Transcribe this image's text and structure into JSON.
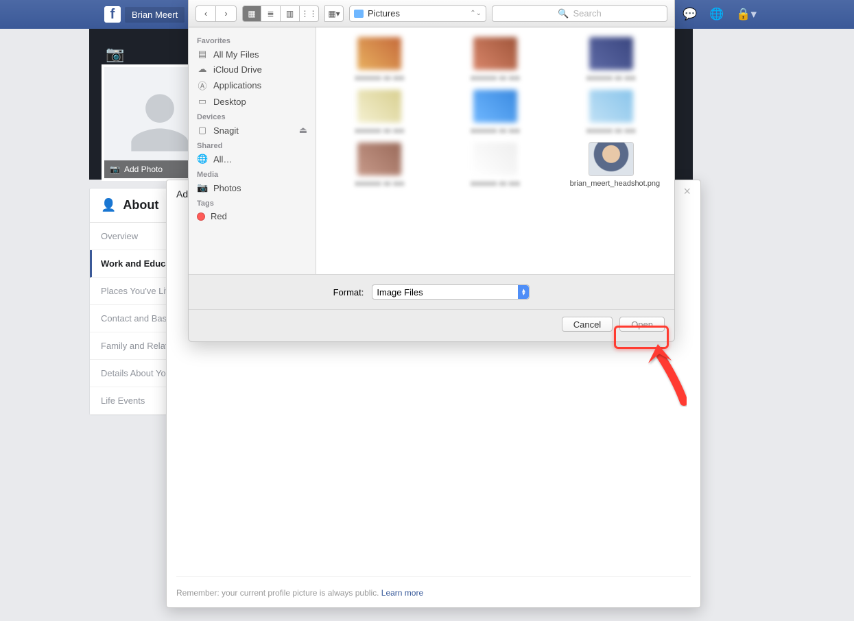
{
  "facebook": {
    "user_name": "Brian Meert",
    "add_photo_label": "Add Photo",
    "about_header": "About",
    "about_items": [
      "Overview",
      "Work and Education",
      "Places You've Lived",
      "Contact and Basic Info",
      "Family and Relationships",
      "Details About You",
      "Life Events"
    ],
    "active_index": 1
  },
  "modal": {
    "title_prefix": "Ad",
    "close_glyph": "×",
    "footer_text": "Remember: your current profile picture is always public. ",
    "footer_link": "Learn more"
  },
  "finder": {
    "path_label": "Pictures",
    "search_placeholder": "Search",
    "format_label": "Format:",
    "format_value": "Image Files",
    "cancel_label": "Cancel",
    "open_label": "Open",
    "sidebar": {
      "favorites_head": "Favorites",
      "favorites": [
        "All My Files",
        "iCloud Drive",
        "Applications",
        "Desktop"
      ],
      "devices_head": "Devices",
      "devices": [
        "Snagit"
      ],
      "shared_head": "Shared",
      "shared": [
        "All…"
      ],
      "media_head": "Media",
      "media": [
        "Photos"
      ],
      "tags_head": "Tags",
      "tags": [
        {
          "name": "Red",
          "color": "#ff5b57"
        }
      ]
    },
    "files": {
      "visible_name": "brian_meert_headshot.png"
    }
  }
}
